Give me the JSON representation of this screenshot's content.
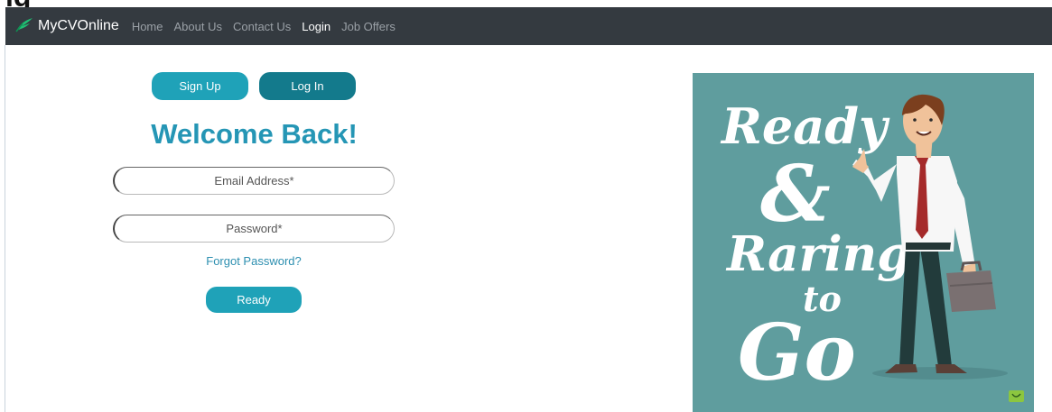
{
  "window": {
    "top_strip_text": "ig"
  },
  "navbar": {
    "brand": "MyCVOnline",
    "links": [
      {
        "label": "Home",
        "active": false
      },
      {
        "label": "About Us",
        "active": false
      },
      {
        "label": "Contact Us",
        "active": false
      },
      {
        "label": "Login",
        "active": true
      },
      {
        "label": "Job Offers",
        "active": false
      }
    ]
  },
  "auth": {
    "tabs": {
      "signup": "Sign Up",
      "login": "Log In"
    },
    "title": "Welcome Back!",
    "email_placeholder": "Email Address*",
    "password_placeholder": "Password*",
    "forgot_label": "Forgot Password?",
    "submit_label": "Ready"
  },
  "poster": {
    "line1": "Ready",
    "line2": "&",
    "line3": "Raring",
    "line4": "to",
    "line5": "Go"
  },
  "colors": {
    "nav_bg": "#343a40",
    "accent": "#1fa2b8",
    "accent_dark": "#137a8c",
    "title": "#2596b5",
    "poster_bg": "#5f9d9e"
  },
  "icons": {
    "brand": "leaf-logo-icon",
    "poster_corner": "green-badge-icon"
  }
}
